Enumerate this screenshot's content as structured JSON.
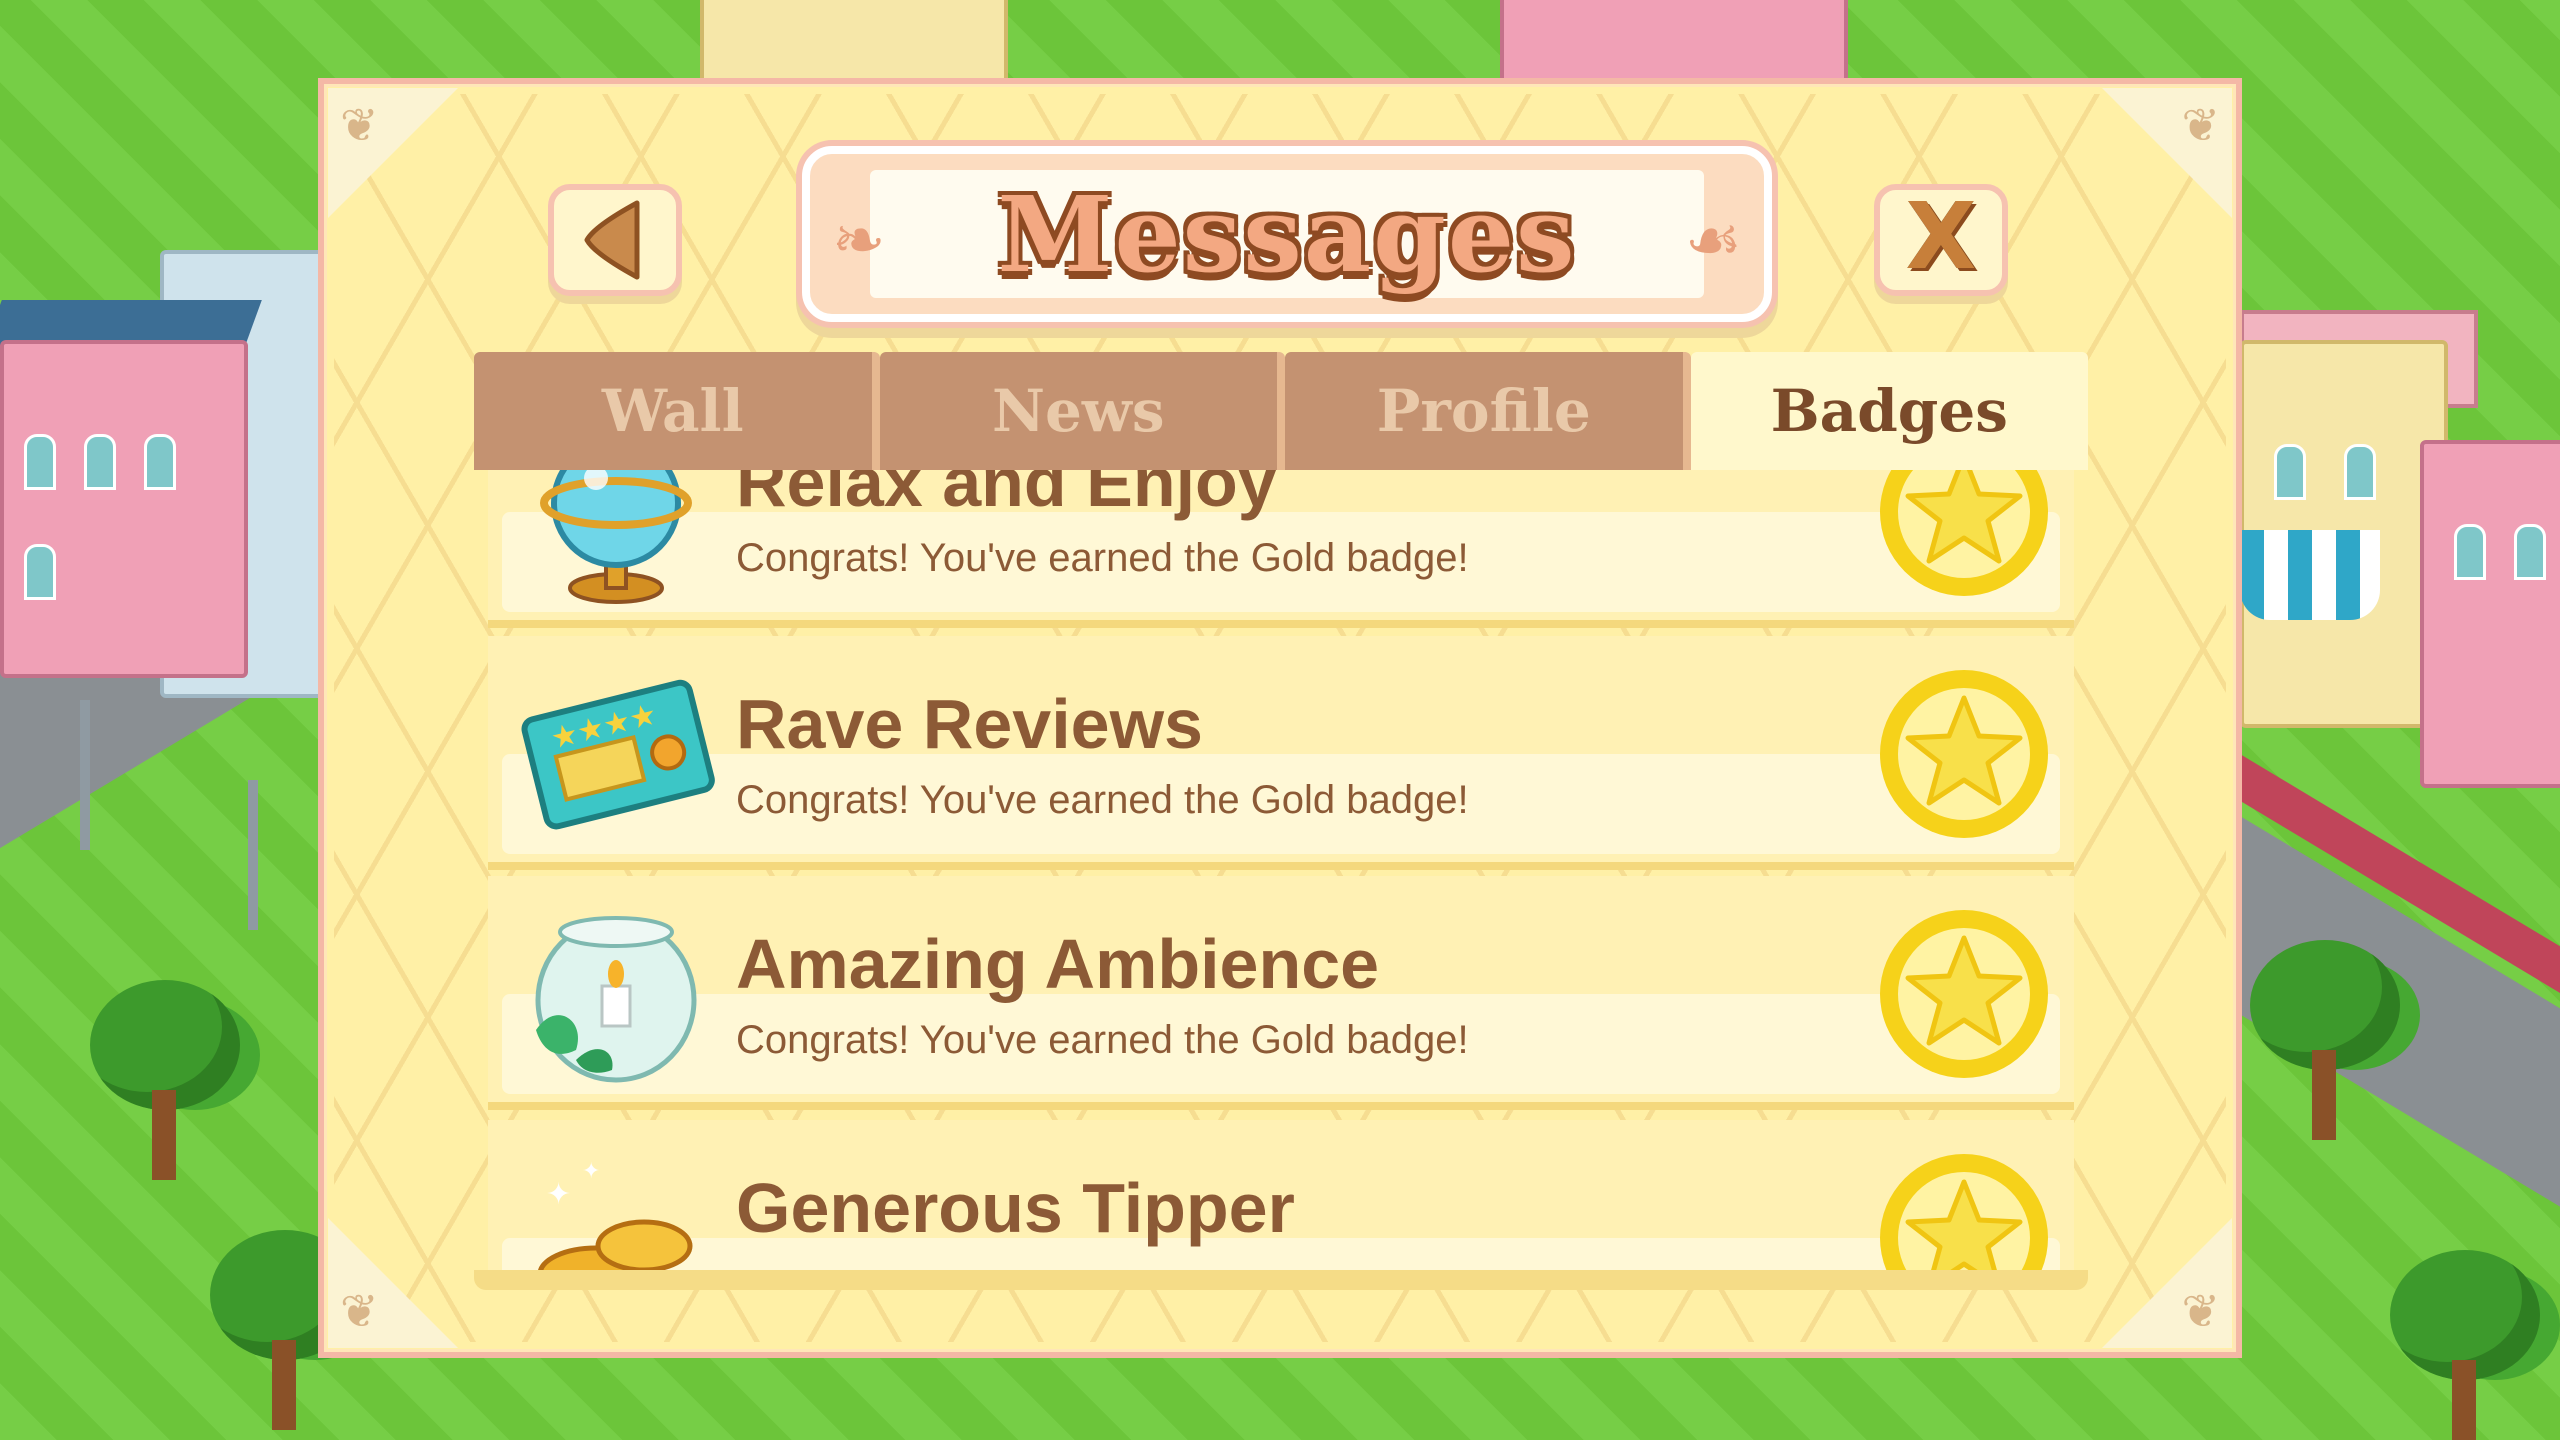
{
  "dialog": {
    "title": "Messages",
    "back_button": "back",
    "close_label": "X"
  },
  "tabs": [
    {
      "label": "Wall",
      "active": false
    },
    {
      "label": "News",
      "active": false
    },
    {
      "label": "Profile",
      "active": false
    },
    {
      "label": "Badges",
      "active": true
    }
  ],
  "badges": [
    {
      "title": "Relax and Enjoy",
      "desc": "Congrats! You've earned the Gold badge!",
      "icon": "globe-lamp-icon",
      "badge": "gold-star-badge-icon"
    },
    {
      "title": "Rave Reviews",
      "desc": "Congrats! You've earned the Gold badge!",
      "icon": "review-card-icon",
      "badge": "gold-star-badge-icon"
    },
    {
      "title": "Amazing Ambience",
      "desc": "Congrats! You've earned the Gold badge!",
      "icon": "candle-bowl-icon",
      "badge": "gold-star-badge-icon"
    },
    {
      "title": "Generous Tipper",
      "desc": "",
      "icon": "gold-coins-icon",
      "badge": "gold-star-badge-icon"
    }
  ],
  "colors": {
    "panel": "#fff0a6",
    "tab_inactive": "#c49271",
    "tab_active": "#fff8cc",
    "text_brown": "#8c5a36",
    "badge_gold": "#f5d21b"
  }
}
